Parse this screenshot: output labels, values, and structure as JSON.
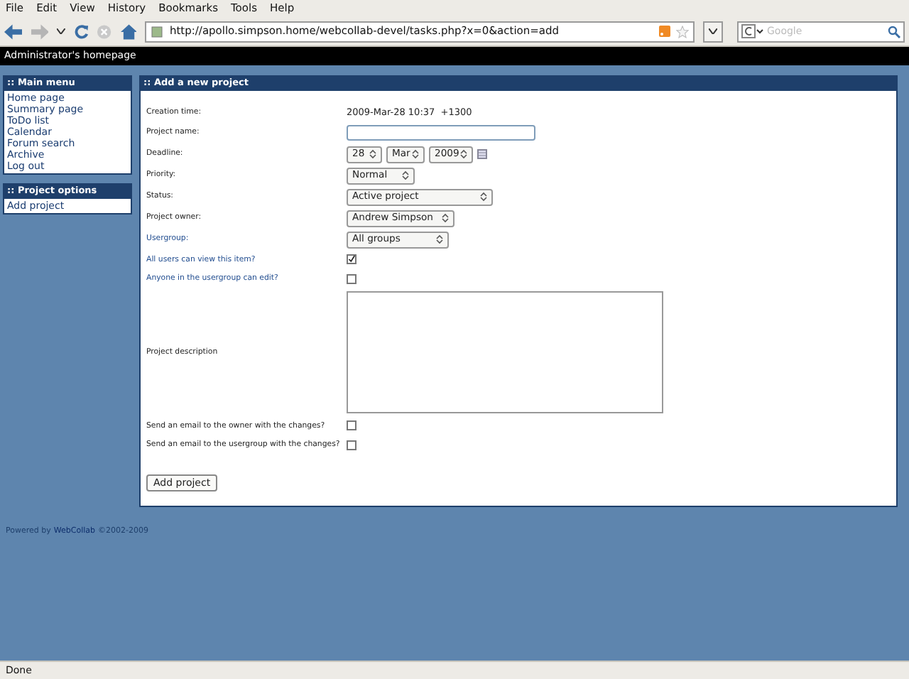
{
  "menubar": [
    "File",
    "Edit",
    "View",
    "History",
    "Bookmarks",
    "Tools",
    "Help"
  ],
  "address": {
    "value": "http://apollo.simpson.home/webcollab-devel/tasks.php?x=0&action=add"
  },
  "search": {
    "placeholder": "Google"
  },
  "top_bar": "Administrator's homepage",
  "sidebar": [
    {
      "title": ":: Main menu",
      "items": [
        "Home page",
        "Summary page",
        "ToDo list",
        "Calendar",
        "Forum search",
        "Archive",
        "Log out"
      ]
    },
    {
      "title": ":: Project options",
      "items": [
        "Add project"
      ]
    }
  ],
  "form": {
    "title": ":: Add a new project",
    "rows": [
      {
        "kind": "text",
        "label": "Creation time:",
        "linked": false,
        "value": "2009-Mar-28 10:37  +1300"
      },
      {
        "kind": "input",
        "label": "Project name:",
        "linked": false
      },
      {
        "kind": "date",
        "label": "Deadline:",
        "linked": false,
        "selects": [
          "28",
          "Mar",
          "2009"
        ]
      },
      {
        "kind": "select",
        "label": "Priority:",
        "linked": false,
        "value": "Normal"
      },
      {
        "kind": "select",
        "label": "Status:",
        "linked": false,
        "value": "Active project"
      },
      {
        "kind": "select",
        "label": "Project owner:",
        "linked": false,
        "value": "Andrew Simpson"
      },
      {
        "kind": "select",
        "label": "Usergroup:",
        "linked": true,
        "value": "All groups"
      },
      {
        "kind": "checkbox",
        "label": "All users can view this item?",
        "linked": true,
        "checked": true
      },
      {
        "kind": "checkbox",
        "label": "Anyone in the usergroup can edit?",
        "linked": true,
        "checked": false
      },
      {
        "kind": "textarea",
        "label": "Project description",
        "linked": false
      },
      {
        "kind": "checkbox",
        "label": "Send an email to the owner with the changes?",
        "linked": false,
        "checked": false
      },
      {
        "kind": "checkbox",
        "label": "Send an email to the usergroup with the changes?",
        "linked": false,
        "checked": false
      }
    ],
    "button": "Add project"
  },
  "footer": {
    "prefix": "Powered by",
    "link": "WebCollab",
    "suffix": "©2002-2009"
  },
  "status_bar": "Done"
}
